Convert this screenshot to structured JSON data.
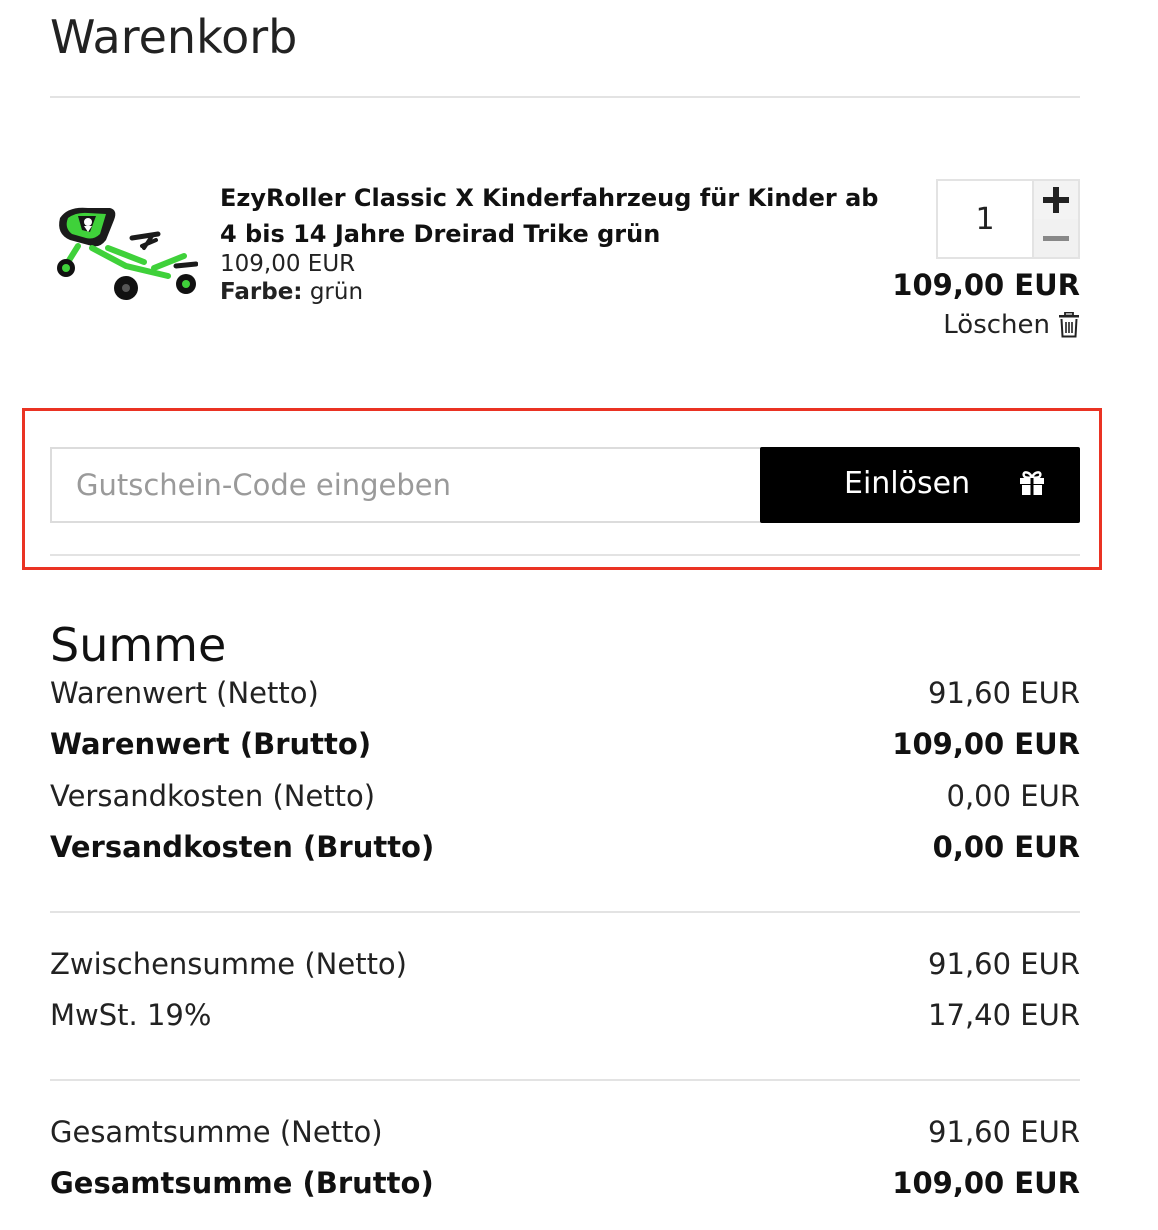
{
  "page": {
    "title": "Warenkorb"
  },
  "cart_item": {
    "name": "EzyRoller Classic X Kinderfahrzeug für Kinder ab 4 bis 14 Jahre Dreirad Trike grün",
    "unit_price": "109,00 EUR",
    "variant_label": "Farbe:",
    "variant_value": "grün",
    "quantity": "1",
    "total": "109,00 EUR",
    "delete_label": "Löschen",
    "image_icon": "product-trike-image"
  },
  "coupon": {
    "placeholder": "Gutschein-Code eingeben",
    "button_label": "Einlösen",
    "button_icon": "gift-icon",
    "highlight_color": "#ea3323"
  },
  "summary": {
    "title": "Summe",
    "rows": [
      {
        "label": "Warenwert (Netto)",
        "value": "91,60 EUR"
      },
      {
        "label": "Warenwert (Brutto)",
        "value": "109,00 EUR"
      },
      {
        "label": "Versandkosten (Netto)",
        "value": "0,00 EUR"
      },
      {
        "label": "Versandkosten (Brutto)",
        "value": "0,00 EUR"
      },
      {
        "label": "Zwischensumme (Netto)",
        "value": "91,60 EUR"
      },
      {
        "label": "MwSt. 19%",
        "value": "17,40 EUR"
      },
      {
        "label": "Gesamtsumme (Netto)",
        "value": "91,60 EUR"
      },
      {
        "label": "Gesamtsumme (Brutto)",
        "value": "109,00 EUR"
      }
    ]
  },
  "colors": {
    "accent_green": "#3fd13a",
    "button_bg": "#000000",
    "divider": "#e3e3e3"
  }
}
